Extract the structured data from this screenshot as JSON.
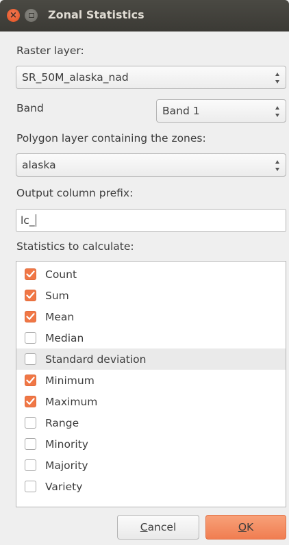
{
  "window": {
    "title": "Zonal Statistics",
    "close_glyph": "×"
  },
  "raster": {
    "label": "Raster layer:",
    "value": "SR_50M_alaska_nad"
  },
  "band": {
    "label": "Band",
    "value": "Band 1"
  },
  "polygon": {
    "label": "Polygon layer containing the zones:",
    "value": "alaska"
  },
  "prefix": {
    "label": "Output column prefix:",
    "value": "lc_"
  },
  "statistics": {
    "label": "Statistics to calculate:",
    "items": [
      {
        "label": "Count",
        "checked": true
      },
      {
        "label": "Sum",
        "checked": true
      },
      {
        "label": "Mean",
        "checked": true
      },
      {
        "label": "Median",
        "checked": false
      },
      {
        "label": "Standard deviation",
        "checked": false
      },
      {
        "label": "Minimum",
        "checked": true
      },
      {
        "label": "Maximum",
        "checked": true
      },
      {
        "label": "Range",
        "checked": false
      },
      {
        "label": "Minority",
        "checked": false
      },
      {
        "label": "Majority",
        "checked": false
      },
      {
        "label": "Variety",
        "checked": false
      }
    ]
  },
  "buttons": {
    "cancel_mnemonic": "C",
    "cancel_rest": "ancel",
    "ok_mnemonic": "O",
    "ok_rest": "K"
  },
  "colors": {
    "accent": "#f07746",
    "titlebar": "#3c3b37"
  }
}
